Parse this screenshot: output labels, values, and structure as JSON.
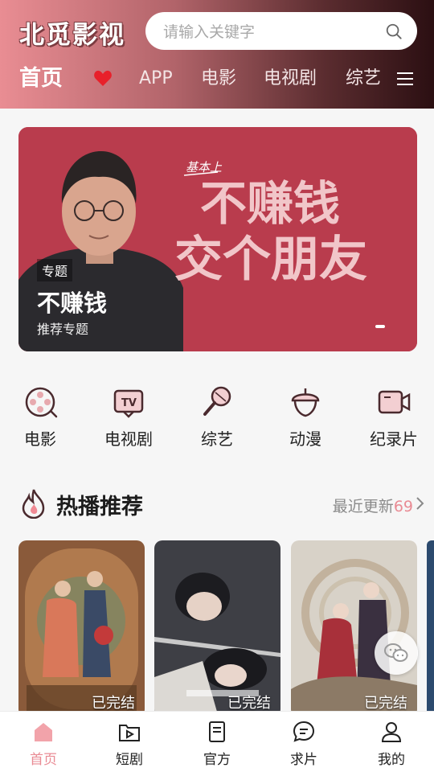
{
  "header": {
    "app_title": "北觅影视",
    "search_placeholder": "请输入关键字",
    "nav": [
      {
        "label": "首页",
        "active": true
      },
      {
        "label": "APP"
      },
      {
        "label": "电影"
      },
      {
        "label": "电视剧"
      },
      {
        "label": "综艺"
      }
    ]
  },
  "banner": {
    "art_caption_small": "基本上",
    "art_line1": "不赚钱",
    "art_line2": "交个朋友",
    "tag": "专题",
    "title": "不赚钱",
    "subtitle": "推荐专题"
  },
  "categories": [
    {
      "label": "电影",
      "icon": "film-reel-icon"
    },
    {
      "label": "电视剧",
      "icon": "tv-icon"
    },
    {
      "label": "综艺",
      "icon": "microphone-icon"
    },
    {
      "label": "动漫",
      "icon": "acorn-icon"
    },
    {
      "label": "纪录片",
      "icon": "camera-icon"
    }
  ],
  "hot": {
    "title": "热播推荐",
    "more_label": "最近更新",
    "more_count": "69"
  },
  "posters": [
    {
      "status": "已完结"
    },
    {
      "status": "已完结"
    },
    {
      "status": "已完结"
    }
  ],
  "tabs": [
    {
      "label": "首页",
      "icon": "home-icon",
      "active": true
    },
    {
      "label": "短剧",
      "icon": "play-folder-icon"
    },
    {
      "label": "官方",
      "icon": "document-icon"
    },
    {
      "label": "求片",
      "icon": "chat-icon"
    },
    {
      "label": "我的",
      "icon": "user-icon"
    }
  ],
  "colors": {
    "accent": "#e98b94",
    "banner_bg": "#b83d4e",
    "header_start": "#e98d93",
    "header_end": "#2b0f12"
  }
}
